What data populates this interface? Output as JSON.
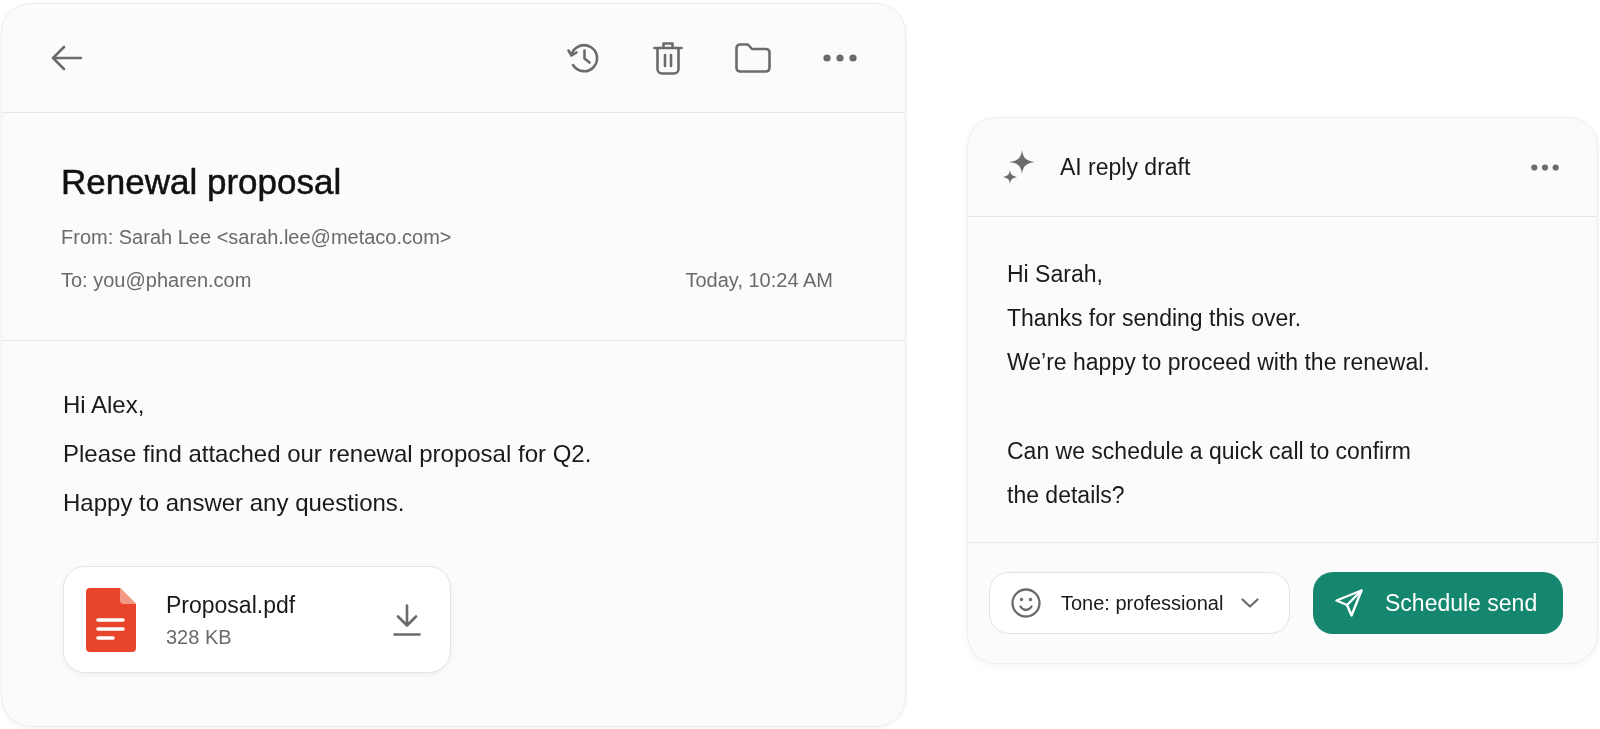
{
  "email": {
    "subject": "Renewal proposal",
    "from": "From: Sarah Lee <sarah.lee@metaco.com>",
    "to": "To: you@pharen.com",
    "time": "Today, 10:24 AM",
    "body": [
      "Hi Alex,",
      "Please find attached our renewal proposal for Q2.",
      "Happy to answer any questions."
    ],
    "attachment": {
      "name": "Proposal.pdf",
      "size": "328 KB"
    }
  },
  "draft": {
    "title": "AI reply draft",
    "paragraphs": [
      [
        "Hi Sarah,",
        "Thanks for sending this over.",
        "We’re happy to proceed with the renewal."
      ],
      [
        "Can we schedule a quick call to confirm the details?"
      ]
    ],
    "tone": "Tone: professional",
    "send_button": "Schedule send"
  }
}
